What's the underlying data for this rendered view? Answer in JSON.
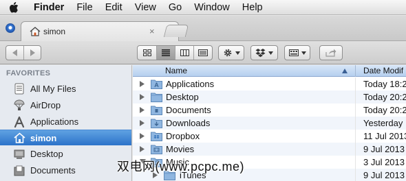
{
  "menubar": {
    "app": "Finder",
    "items": [
      "File",
      "Edit",
      "View",
      "Go",
      "Window",
      "Help"
    ]
  },
  "tab": {
    "title": "simon",
    "close": "×"
  },
  "sidebar": {
    "heading": "FAVORITES",
    "items": [
      {
        "label": "All My Files",
        "icon": "all-files-icon"
      },
      {
        "label": "AirDrop",
        "icon": "airdrop-icon"
      },
      {
        "label": "Applications",
        "icon": "applications-icon"
      },
      {
        "label": "simon",
        "icon": "home-icon",
        "selected": true
      },
      {
        "label": "Desktop",
        "icon": "desktop-icon"
      },
      {
        "label": "Documents",
        "icon": "documents-icon"
      }
    ]
  },
  "columns": {
    "name": "Name",
    "date": "Date Modif"
  },
  "files": [
    {
      "name": "Applications",
      "date": "Today 18:2"
    },
    {
      "name": "Desktop",
      "date": "Today 20:2"
    },
    {
      "name": "Documents",
      "date": "Today 20:2"
    },
    {
      "name": "Downloads",
      "date": "Yesterday"
    },
    {
      "name": "Dropbox",
      "date": "11 Jul 2013"
    },
    {
      "name": "Movies",
      "date": "9 Jul 2013"
    },
    {
      "name": "Music",
      "date": "3 Jul 2013"
    },
    {
      "name": "iTunes",
      "date": "9 Jul 2013"
    }
  ],
  "watermark": "双电网(www.pcpc.me)",
  "colors": {
    "selection": "#3b80d1",
    "folder": "#8fb6e0",
    "sidebar_bg": "#e6eaf0"
  }
}
